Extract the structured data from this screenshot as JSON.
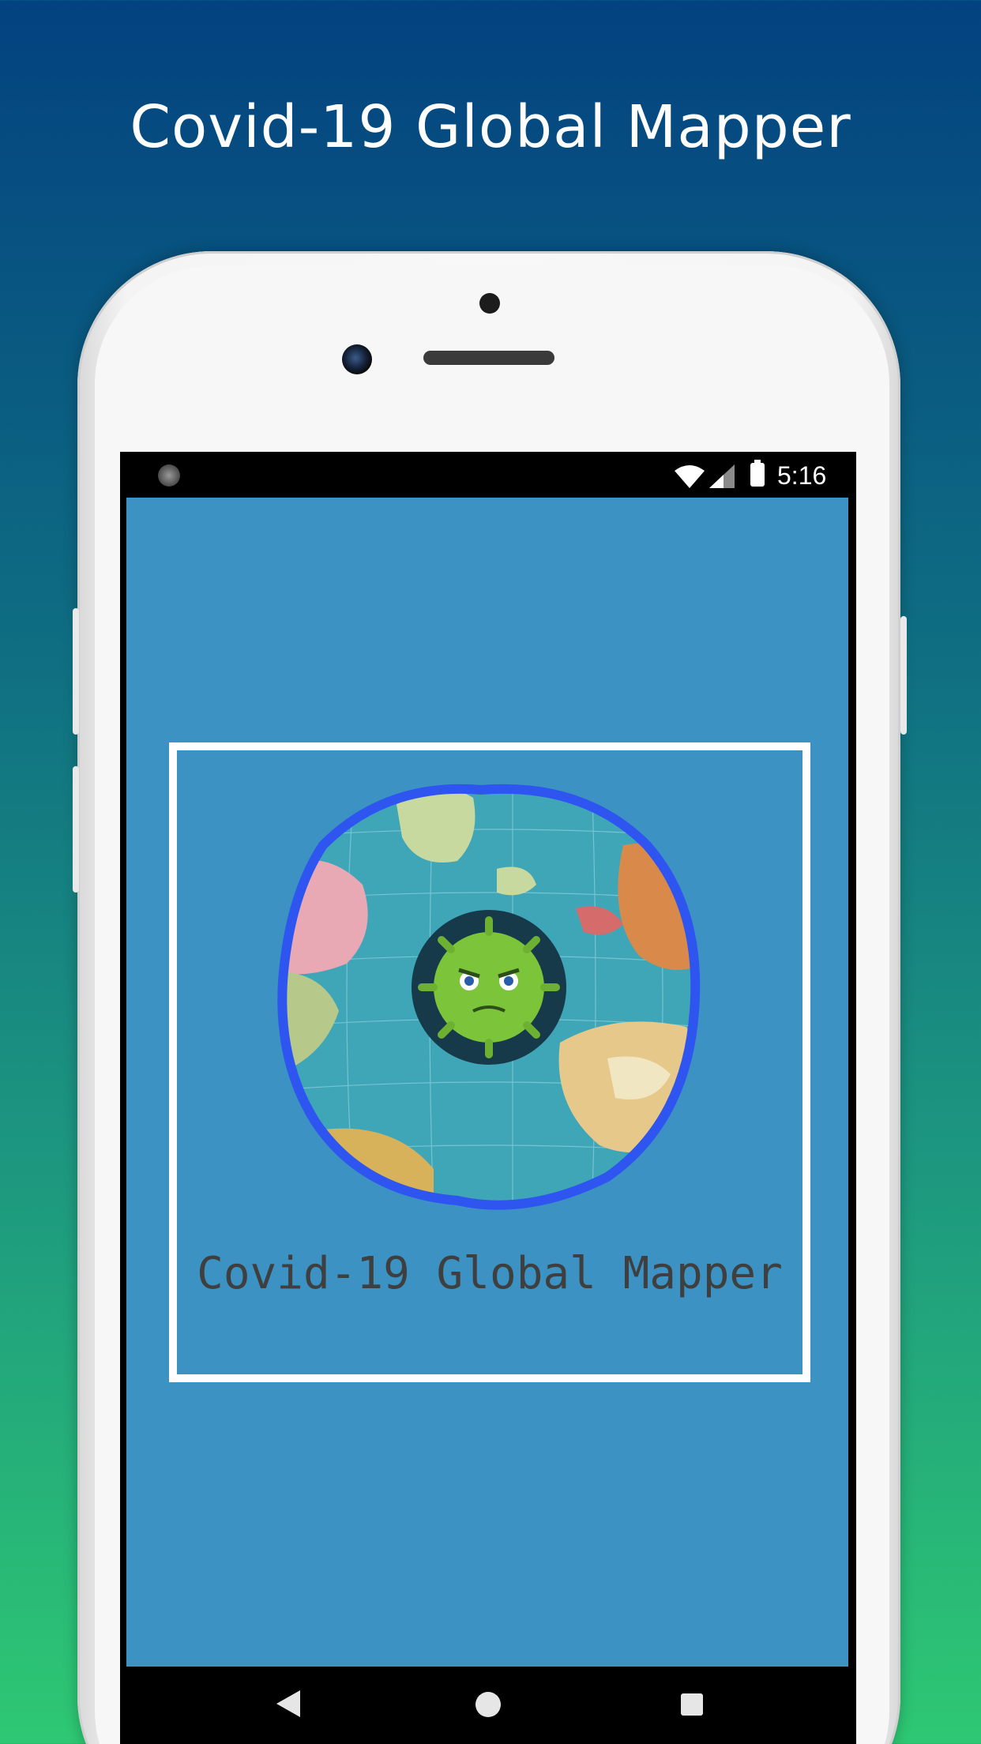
{
  "promo": {
    "title": "Covid-19 Global Mapper"
  },
  "status_bar": {
    "time": "5:16"
  },
  "app": {
    "splash_title": "Covid-19 Global Mapper"
  },
  "colors": {
    "app_background": "#3b92c3",
    "logo_ring": "#2f55f0",
    "virus": "#7cc43a"
  },
  "icons": {
    "status": [
      "wifi-icon",
      "signal-icon",
      "battery-icon"
    ],
    "nav": [
      "back-icon",
      "home-icon",
      "recents-icon"
    ]
  }
}
